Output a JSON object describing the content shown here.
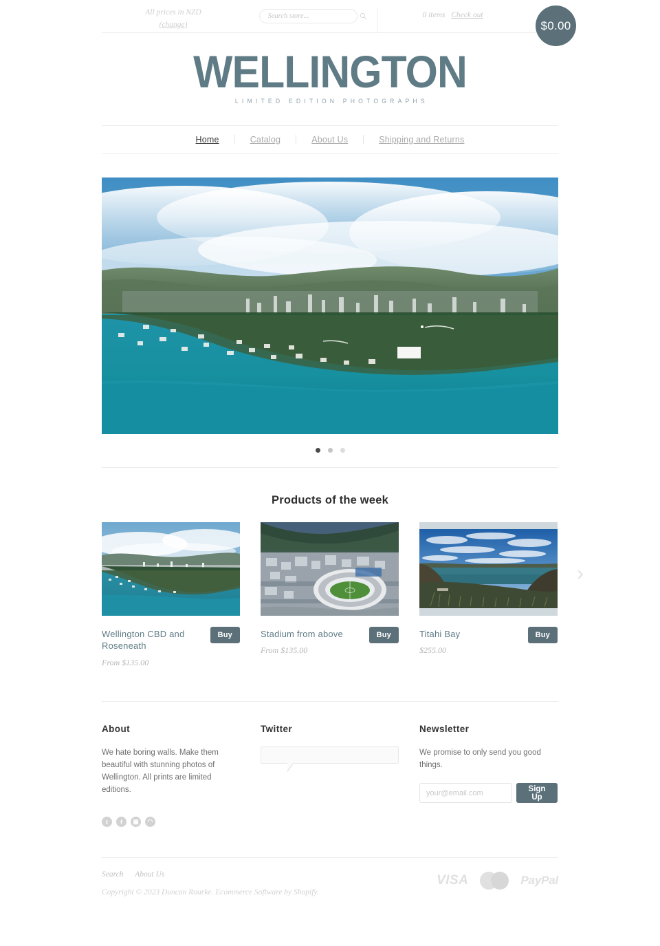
{
  "topbar": {
    "currency_text": "All prices in NZD",
    "currency_change": "(change)",
    "search_placeholder": "Search store...",
    "search_value": "",
    "search_icon": "search-icon",
    "cart_items": "0 items",
    "checkout_label": "Check out",
    "cart_total": "$0.00"
  },
  "brand": {
    "wordmark": "WELLINGTON",
    "tagline": "LIMITED EDITION PHOTOGRAPHS",
    "color": "#5f7b85"
  },
  "nav": {
    "items": [
      {
        "label": "Home",
        "active": true
      },
      {
        "label": "Catalog",
        "active": false
      },
      {
        "label": "About Us",
        "active": false
      },
      {
        "label": "Shipping and Returns",
        "active": false
      }
    ]
  },
  "hero": {
    "alt": "Aerial photograph of Wellington city and harbour",
    "slide_count": 3,
    "active_slide": 1
  },
  "products_section": {
    "heading": "Products of the week",
    "next_arrow": "chevron-right-icon",
    "items": [
      {
        "title": "Wellington CBD and Roseneath",
        "price": "From $135.00",
        "buy_label": "Buy",
        "image_alt": "Aerial view of Wellington CBD and Roseneath peninsula"
      },
      {
        "title": "Stadium from above",
        "price": "From $135.00",
        "buy_label": "Buy",
        "image_alt": "Wellington stadium photographed from above"
      },
      {
        "title": "Titahi Bay",
        "price": "$255.00",
        "buy_label": "Buy",
        "image_alt": "Panoramic coastal view of Titahi Bay"
      }
    ]
  },
  "footer": {
    "about": {
      "heading": "About",
      "text": "We hate boring walls. Make them beautiful with stunning photos of Wellington. All prints are limited editions.",
      "socials": [
        {
          "name": "twitter-icon",
          "glyph": "t"
        },
        {
          "name": "facebook-icon",
          "glyph": "f"
        },
        {
          "name": "instagram-icon",
          "glyph": "▣"
        },
        {
          "name": "rss-icon",
          "glyph": "◠"
        }
      ]
    },
    "twitter": {
      "heading": "Twitter",
      "tweet_text": ""
    },
    "newsletter": {
      "heading": "Newsletter",
      "text": "We promise to only send you good things.",
      "email_placeholder": "your@email.com",
      "email_value": "",
      "signup_label": "Sign Up"
    },
    "bottom_links": [
      {
        "label": "Search"
      },
      {
        "label": "About Us"
      }
    ],
    "copyright": "Copyright © 2023 Duncan Rourke. Ecommerce Software by Shopify.",
    "payments": [
      {
        "name": "visa-icon",
        "label": "VISA"
      },
      {
        "name": "mastercard-icon",
        "label": ""
      },
      {
        "name": "paypal-icon",
        "label": "PayPal"
      }
    ]
  }
}
